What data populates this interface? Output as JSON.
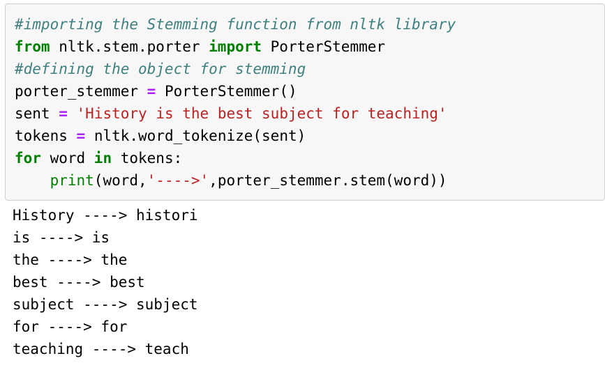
{
  "colors": {
    "page_background": "#ffffff",
    "code_background": "#f7f7f7",
    "code_border": "#cfcfcf",
    "comment": "#408080",
    "keyword": "#008000",
    "builtin": "#008000",
    "string": "#ba2121",
    "operator": "#aa22ff",
    "text": "#000000"
  },
  "code_cell": {
    "language": "python",
    "lines": [
      {
        "index": 0,
        "text": "#importing the Stemming function from nltk library",
        "tokens": [
          {
            "t": "#importing the Stemming function from nltk library",
            "k": "comment"
          }
        ]
      },
      {
        "index": 1,
        "text": "from nltk.stem.porter import PorterStemmer",
        "tokens": [
          {
            "t": "from",
            "k": "keyword"
          },
          {
            "t": " nltk.stem.porter ",
            "k": "plain"
          },
          {
            "t": "import",
            "k": "keyword"
          },
          {
            "t": " PorterStemmer",
            "k": "plain"
          }
        ]
      },
      {
        "index": 2,
        "text": "#defining the object for stemming",
        "tokens": [
          {
            "t": "#defining the object for stemming",
            "k": "comment"
          }
        ]
      },
      {
        "index": 3,
        "text": "porter_stemmer = PorterStemmer()",
        "tokens": [
          {
            "t": "porter_stemmer ",
            "k": "plain"
          },
          {
            "t": "=",
            "k": "operator"
          },
          {
            "t": " PorterStemmer()",
            "k": "plain"
          }
        ]
      },
      {
        "index": 4,
        "text": "sent = 'History is the best subject for teaching'",
        "tokens": [
          {
            "t": "sent ",
            "k": "plain"
          },
          {
            "t": "=",
            "k": "operator"
          },
          {
            "t": " ",
            "k": "plain"
          },
          {
            "t": "'History is the best subject for teaching'",
            "k": "string"
          }
        ]
      },
      {
        "index": 5,
        "text": "tokens = nltk.word_tokenize(sent)",
        "tokens": [
          {
            "t": "tokens ",
            "k": "plain"
          },
          {
            "t": "=",
            "k": "operator"
          },
          {
            "t": " nltk.word_tokenize(sent)",
            "k": "plain"
          }
        ]
      },
      {
        "index": 6,
        "text": "for word in tokens:",
        "tokens": [
          {
            "t": "for",
            "k": "keyword"
          },
          {
            "t": " word ",
            "k": "plain"
          },
          {
            "t": "in",
            "k": "keyword"
          },
          {
            "t": " tokens:",
            "k": "plain"
          }
        ]
      },
      {
        "index": 7,
        "text": "    print(word,'---->',porter_stemmer.stem(word))",
        "tokens": [
          {
            "t": "    ",
            "k": "plain"
          },
          {
            "t": "print",
            "k": "builtin"
          },
          {
            "t": "(word,",
            "k": "plain"
          },
          {
            "t": "'---->'",
            "k": "string"
          },
          {
            "t": ",porter_stemmer.stem(word))",
            "k": "plain"
          }
        ]
      }
    ]
  },
  "output_cell": {
    "lines": [
      "History ----> histori",
      "is ----> is",
      "the ----> the",
      "best ----> best",
      "subject ----> subject",
      "for ----> for",
      "teaching ----> teach"
    ]
  }
}
